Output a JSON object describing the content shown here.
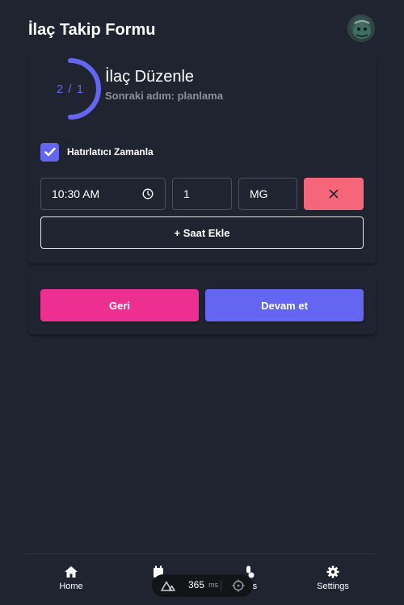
{
  "header": {
    "title": "İlaç Takip Formu"
  },
  "step": {
    "progress_text": "2 / 1",
    "progress_fraction": 0.5,
    "title": "İlaç Düzenle",
    "subtitle": "Sonraki adım: planlama"
  },
  "reminder": {
    "checked": true,
    "label": "Hatırlatıcı Zamanla"
  },
  "schedule": {
    "time": "10:30 AM",
    "quantity": "1",
    "unit": "MG"
  },
  "buttons": {
    "add_time": "+ Saat Ekle",
    "back": "Geri",
    "next": "Devam et"
  },
  "nav": [
    {
      "label": "Home",
      "icon": "home-icon"
    },
    {
      "label": "H",
      "icon": "calendar-icon"
    },
    {
      "label": "ions",
      "icon": "medication-icon"
    },
    {
      "label": "Settings",
      "icon": "gear-icon"
    }
  ],
  "devbar": {
    "value": "365",
    "unit": "ms"
  },
  "colors": {
    "background": "#1f2430",
    "accent": "#6466f1",
    "back_button": "#ec2f91",
    "remove_button": "#f5667a"
  }
}
